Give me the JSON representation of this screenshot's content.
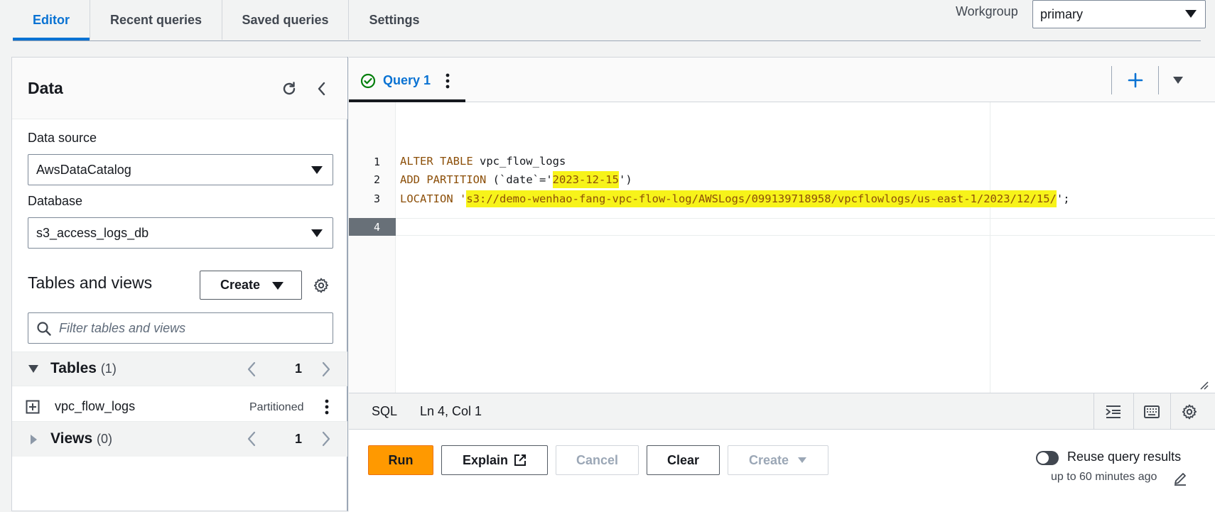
{
  "top_tabs": [
    "Editor",
    "Recent queries",
    "Saved queries",
    "Settings"
  ],
  "workgroup": {
    "label": "Workgroup",
    "value": "primary"
  },
  "data_panel": {
    "title": "Data",
    "data_source_label": "Data source",
    "data_source_value": "AwsDataCatalog",
    "database_label": "Database",
    "database_value": "s3_access_logs_db",
    "tables_views_title": "Tables and views",
    "create_label": "Create",
    "filter_placeholder": "Filter tables and views",
    "tables": {
      "label": "Tables",
      "count": "(1)",
      "page": "1"
    },
    "table_items": [
      {
        "name": "vpc_flow_logs",
        "badge": "Partitioned"
      }
    ],
    "views": {
      "label": "Views",
      "count": "(0)",
      "page": "1"
    }
  },
  "editor": {
    "query_tab": "Query 1",
    "lines": [
      "1",
      "2",
      "3",
      "4"
    ],
    "code": {
      "l1_kw": "ALTER TABLE",
      "l1_rest": " vpc_flow_logs",
      "l2_kw": "ADD PARTITION",
      "l2_a": " (`date`='",
      "l2_hl": "2023-12-15",
      "l2_b": "')",
      "l3_kw": "LOCATION",
      "l3_a": " '",
      "l3_hl": "s3://demo-wenhao-fang-vpc-flow-log/AWSLogs/099139718958/vpcflowlogs/us-east-1/2023/12/15/",
      "l3_b": "';"
    },
    "status_lang": "SQL",
    "status_pos": "Ln 4, Col 1"
  },
  "actions": {
    "run": "Run",
    "explain": "Explain",
    "cancel": "Cancel",
    "clear": "Clear",
    "create": "Create",
    "reuse_label": "Reuse query results",
    "reuse_sub": "up to 60 minutes ago"
  },
  "colors": {
    "accent": "#0972d3",
    "run": "#ff9900",
    "highlight": "#f7f31a",
    "success": "#037f0c"
  }
}
